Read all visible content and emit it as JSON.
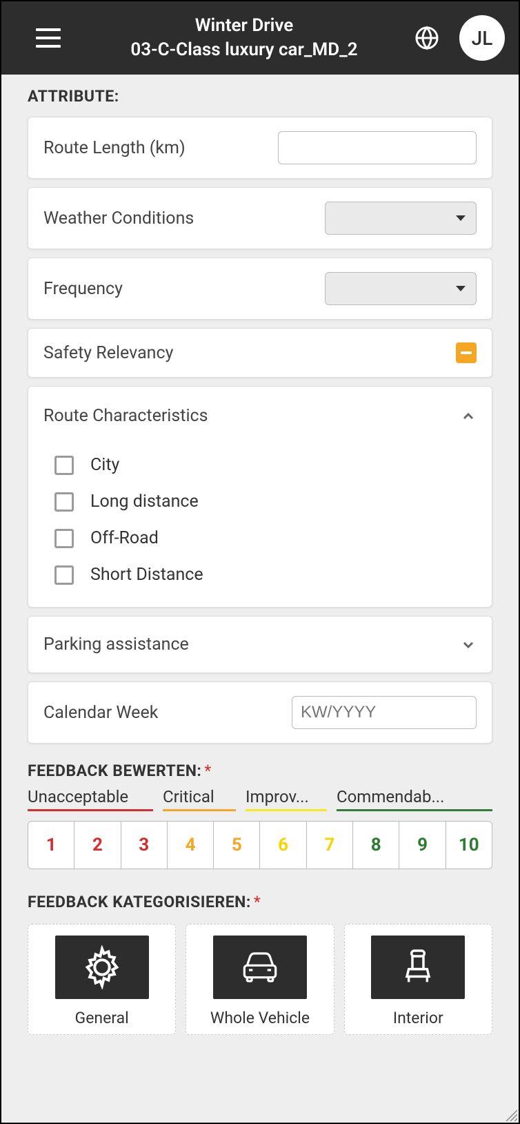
{
  "header": {
    "title_line1": "Winter Drive",
    "title_line2": "03-C-Class luxury car_MD_2",
    "avatar_initials": "JL"
  },
  "attribute": {
    "section_label": "ATTRIBUTE:",
    "route_length_label": "Route Length (km)",
    "route_length_value": "",
    "weather_label": "Weather Conditions",
    "frequency_label": "Frequency",
    "safety_label": "Safety Relevancy",
    "route_char_label": "Route Characteristics",
    "route_options": [
      {
        "label": "City"
      },
      {
        "label": "Long distance"
      },
      {
        "label": "Off-Road"
      },
      {
        "label": "Short Distance"
      }
    ],
    "parking_label": "Parking assistance",
    "calendar_label": "Calendar Week",
    "calendar_placeholder": "KW/YYYY"
  },
  "rating": {
    "section_label": "FEEDBACK BEWERTEN:",
    "labels": {
      "unacceptable": "Unacceptable",
      "critical": "Critical",
      "improv": "Improv...",
      "commendable": "Commendab..."
    },
    "values": [
      "1",
      "2",
      "3",
      "4",
      "5",
      "6",
      "7",
      "8",
      "9",
      "10"
    ]
  },
  "category": {
    "section_label": "FEEDBACK KATEGORISIEREN:",
    "items": [
      {
        "label": "General"
      },
      {
        "label": "Whole Vehicle"
      },
      {
        "label": "Interior"
      }
    ]
  }
}
